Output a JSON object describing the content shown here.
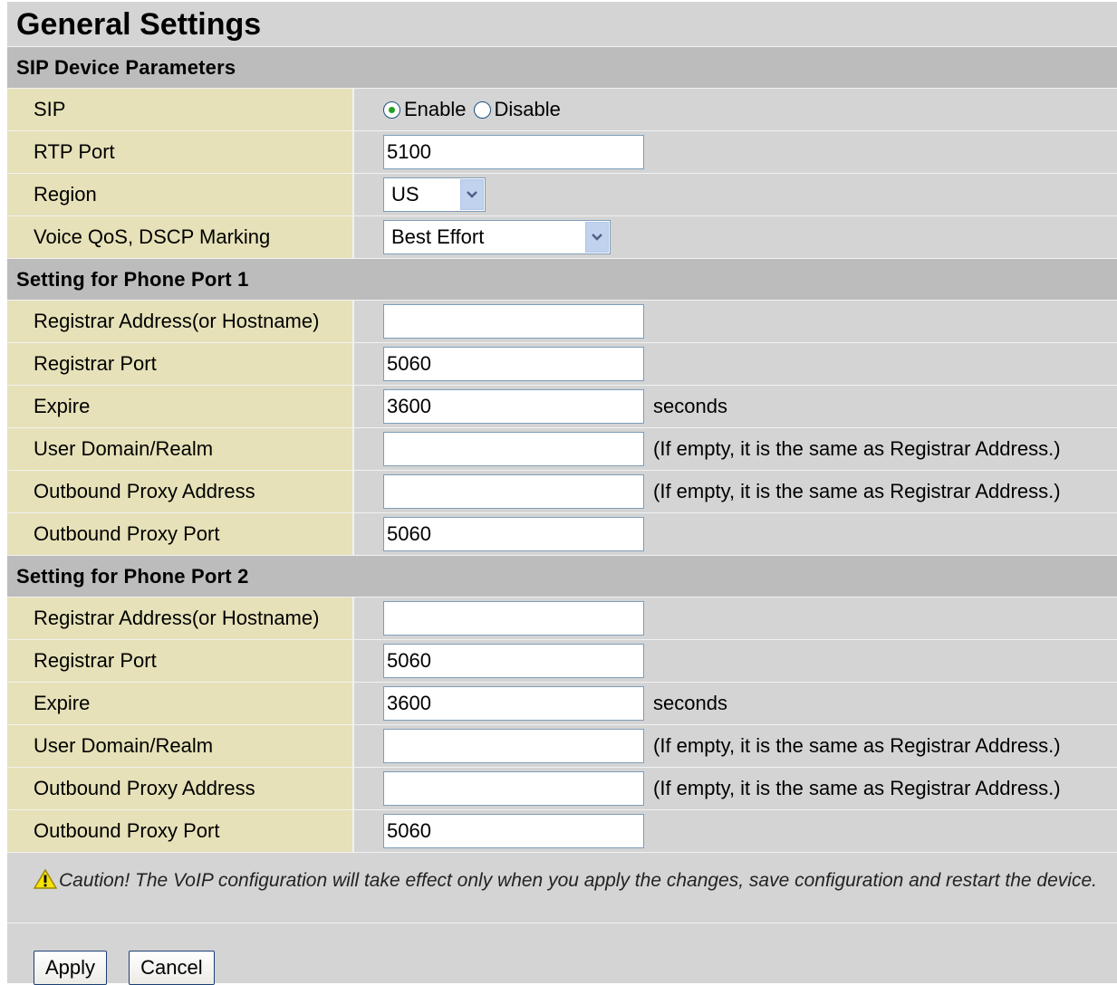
{
  "title": "General Settings",
  "sip_device": {
    "header": "SIP Device Parameters",
    "sip_label": "SIP",
    "sip_enable": "Enable",
    "sip_disable": "Disable",
    "sip_selected": "Enable",
    "rtp_label": "RTP Port",
    "rtp_value": "5100",
    "region_label": "Region",
    "region_value": "US",
    "qos_label": "Voice QoS, DSCP Marking",
    "qos_value": "Best Effort"
  },
  "port1": {
    "header": "Setting for Phone Port 1",
    "registrar_address_label": "Registrar Address(or Hostname)",
    "registrar_address_value": "",
    "registrar_port_label": "Registrar Port",
    "registrar_port_value": "5060",
    "expire_label": "Expire",
    "expire_value": "3600",
    "expire_unit": "seconds",
    "user_domain_label": "User Domain/Realm",
    "user_domain_value": "",
    "user_domain_hint": "(If empty, it is the same as Registrar Address.)",
    "outbound_proxy_address_label": "Outbound Proxy Address",
    "outbound_proxy_address_value": "",
    "outbound_proxy_address_hint": "(If empty, it is the same as Registrar Address.)",
    "outbound_proxy_port_label": "Outbound Proxy Port",
    "outbound_proxy_port_value": "5060"
  },
  "port2": {
    "header": "Setting for Phone Port 2",
    "registrar_address_label": "Registrar Address(or Hostname)",
    "registrar_address_value": "",
    "registrar_port_label": "Registrar Port",
    "registrar_port_value": "5060",
    "expire_label": "Expire",
    "expire_value": "3600",
    "expire_unit": "seconds",
    "user_domain_label": "User Domain/Realm",
    "user_domain_value": "",
    "user_domain_hint": "(If empty, it is the same as Registrar Address.)",
    "outbound_proxy_address_label": "Outbound Proxy Address",
    "outbound_proxy_address_value": "",
    "outbound_proxy_address_hint": "(If empty, it is the same as Registrar Address.)",
    "outbound_proxy_port_label": "Outbound Proxy Port",
    "outbound_proxy_port_value": "5060"
  },
  "caution": {
    "text": "Caution! The VoIP configuration will take effect only when you apply the changes, save configuration and restart the device.",
    "icon": "warning-icon"
  },
  "buttons": {
    "apply": "Apply",
    "cancel": "Cancel"
  },
  "colors": {
    "label_bg": "#e6e1b8",
    "section_bg": "#bcbcbc",
    "panel_bg": "#d4d4d4",
    "radio_check": "#21a121"
  }
}
